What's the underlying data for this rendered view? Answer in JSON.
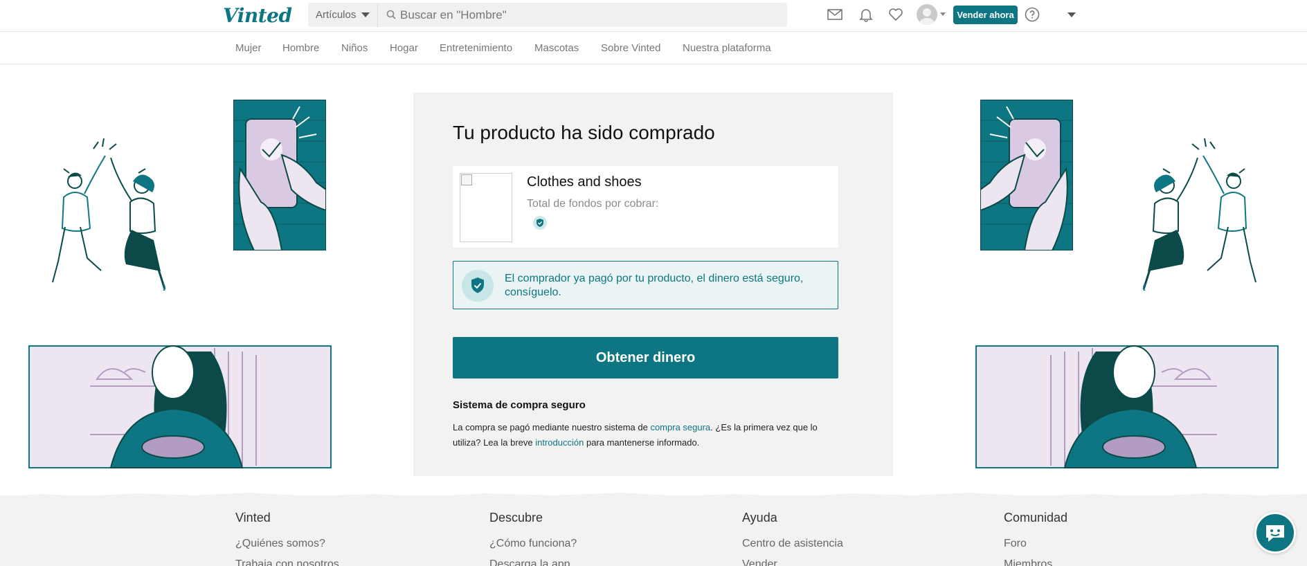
{
  "header": {
    "logo_text": "Vinted",
    "category_select": "Artículos",
    "search_placeholder": "Buscar en \"Hombre\"",
    "sell_button": "Vender ahora",
    "icons": [
      "mail-icon",
      "bell-icon",
      "heart-icon",
      "avatar",
      "help-icon"
    ]
  },
  "nav": {
    "items": [
      "Mujer",
      "Hombre",
      "Niños",
      "Hogar",
      "Entretenimiento",
      "Mascotas",
      "Sobre Vinted",
      "Nuestra plataforma"
    ]
  },
  "card": {
    "title": "Tu producto ha sido comprado",
    "item": {
      "name": "Clothes and shoes",
      "funds_label": "Total de fondos por cobrar:"
    },
    "alert_text": "El comprador ya pagó por tu producto, el dinero está seguro, consíguelo.",
    "primary_button": "Obtener dinero",
    "secure": {
      "title": "Sistema de compra seguro",
      "text_1": "La compra se pagó mediante nuestro sistema de ",
      "link_1": "compra segura",
      "text_2": ". ¿Es la primera vez que lo utiliza? Lea la breve ",
      "link_2": "introducción",
      "text_3": " para mantenerse informado."
    }
  },
  "footer": {
    "columns": [
      {
        "heading": "Vinted",
        "link": "¿Quiénes somos?",
        "link2": "Trabaja con nosotros"
      },
      {
        "heading": "Descubre",
        "link": "¿Cómo funciona?",
        "link2": "Descarga la app"
      },
      {
        "heading": "Ayuda",
        "link": "Centro de asistencia",
        "link2": "Vender"
      },
      {
        "heading": "Comunidad",
        "link": "Foro",
        "link2": "Miembros"
      }
    ]
  },
  "colors": {
    "accent": "#0d7682",
    "card_bg": "#f2f2f2",
    "illustration_lilac": "#d9c9e2",
    "illustration_dark": "#0b4a48"
  }
}
